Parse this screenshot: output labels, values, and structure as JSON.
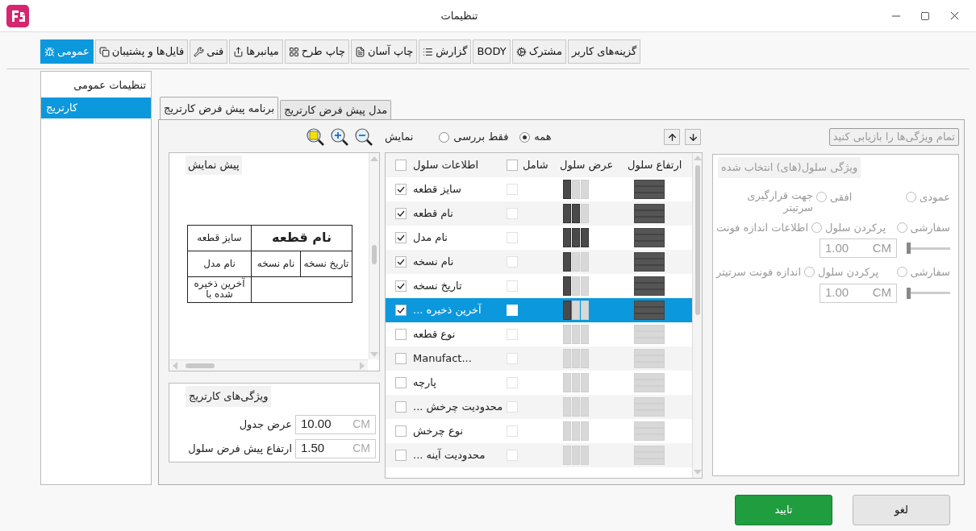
{
  "window": {
    "title": "تنظیمات"
  },
  "tabs": [
    {
      "label": "گزینه‌های کاربر",
      "selected": false
    },
    {
      "label": "مشترک",
      "selected": false
    },
    {
      "label": "BODY",
      "selected": false
    },
    {
      "label": "گزارش",
      "selected": false
    },
    {
      "label": "چاپ آسان",
      "selected": false
    },
    {
      "label": "چاپ طرح",
      "selected": false
    },
    {
      "label": "میانبرها",
      "selected": false
    },
    {
      "label": "فنی",
      "selected": false
    },
    {
      "label": "فایل‌ها و پشتیبان",
      "selected": false
    },
    {
      "label": "عمومی",
      "selected": true
    }
  ],
  "sidebar": {
    "items": [
      {
        "label": "تنظیمات عمومی",
        "selected": false,
        "children": [
          {
            "label": "کارتریج",
            "selected": true
          }
        ]
      }
    ]
  },
  "subtabs": [
    {
      "label": "مدل پیش فرض کارتریج",
      "selected": false
    },
    {
      "label": "برنامه پیش فرض کارتریج",
      "selected": true
    }
  ],
  "preview": {
    "view_label": "نمایش",
    "title": "پیش نمایش",
    "rows": [
      {
        "cells": [
          {
            "text": "نام قطعه",
            "kind": "heading"
          },
          {
            "text": "سایز قطعه",
            "kind": "normal"
          }
        ]
      },
      {
        "cells": [
          {
            "text": "تاریخ نسخه",
            "kind": "normal"
          },
          {
            "text": "نام نسخه",
            "kind": "normal"
          },
          {
            "text": "نام مدل",
            "kind": "normal"
          }
        ]
      },
      {
        "cells": [
          {
            "kind": "blank"
          },
          {
            "text": "آخرین ذخیره شده با",
            "kind": "normal"
          }
        ]
      }
    ]
  },
  "cartridge_properties": {
    "title": "ویژگی‌های کارتریج",
    "fields": [
      {
        "label": "عرض جدول",
        "value": "10.00",
        "unit": "CM"
      },
      {
        "label": "ارتفاع پیش فرض سلول",
        "value": "1.50",
        "unit": "CM"
      }
    ]
  },
  "filter": {
    "options": [
      {
        "label": "همه",
        "selected": true
      },
      {
        "label": "فقط بررسی",
        "selected": false
      }
    ]
  },
  "table": {
    "columns": [
      "ارتفاع سلول",
      "عرض سلول",
      "شامل",
      "اطلاعات سلول"
    ],
    "all_checked": false,
    "all_included": false,
    "rows": [
      {
        "label": "سایز قطعه",
        "checked": true,
        "included": false,
        "selected": false,
        "kind": "narrow"
      },
      {
        "label": "نام قطعه",
        "checked": true,
        "included": false,
        "selected": false,
        "kind": "medium"
      },
      {
        "label": "نام مدل",
        "checked": true,
        "included": false,
        "selected": false,
        "kind": "full"
      },
      {
        "label": "نام نسخه",
        "checked": true,
        "included": false,
        "selected": false,
        "kind": "narrow"
      },
      {
        "label": "تاریخ نسخه",
        "checked": true,
        "included": false,
        "selected": false,
        "kind": "narrow"
      },
      {
        "label": "... آخرین ذخیره",
        "checked": true,
        "included": false,
        "selected": true,
        "kind": "narrow"
      },
      {
        "label": "نوع قطعه",
        "checked": false,
        "included": false,
        "selected": false,
        "kind": "none"
      },
      {
        "label": "Manufact...",
        "checked": false,
        "included": false,
        "selected": false,
        "kind": "none"
      },
      {
        "label": "پارچه",
        "checked": false,
        "included": false,
        "selected": false,
        "kind": "none"
      },
      {
        "label": "... محدودیت چرخش",
        "checked": false,
        "included": false,
        "selected": false,
        "kind": "none"
      },
      {
        "label": "نوع چرخش",
        "checked": false,
        "included": false,
        "selected": false,
        "kind": "none"
      },
      {
        "label": "... محدودیت آینه",
        "checked": false,
        "included": false,
        "selected": false,
        "kind": "none"
      }
    ]
  },
  "cell_properties": {
    "reset_button": {
      "label": "تمام ویژگی‌ها را بازیابی کنید",
      "disabled": true
    },
    "title": "ویژگی سلول(های) انتخاب شده",
    "disabled": true,
    "settings": [
      {
        "kind": "orientation",
        "label": "جهت قرارگیری سرتیتر",
        "options": [
          {
            "label": "عمودی",
            "selected": false
          },
          {
            "label": "افقی",
            "selected": false
          }
        ]
      },
      {
        "kind": "size",
        "label": "اطلاعات اندازه فونت",
        "options": [
          {
            "label": "سفارشی",
            "selected": false
          },
          {
            "label": "پرکردن سلول",
            "selected": false
          }
        ],
        "value": "1.00",
        "unit": "CM",
        "level": 0
      },
      {
        "kind": "size",
        "label": "اندازه فونت سرتیتر",
        "options": [
          {
            "label": "سفارشی",
            "selected": false
          },
          {
            "label": "پرکردن سلول",
            "selected": false
          }
        ],
        "value": "1.00",
        "unit": "CM",
        "level": 0
      }
    ]
  },
  "buttons": [
    {
      "label": "لغو",
      "kind": "secondary"
    },
    {
      "label": "تایید",
      "kind": "primary"
    }
  ]
}
